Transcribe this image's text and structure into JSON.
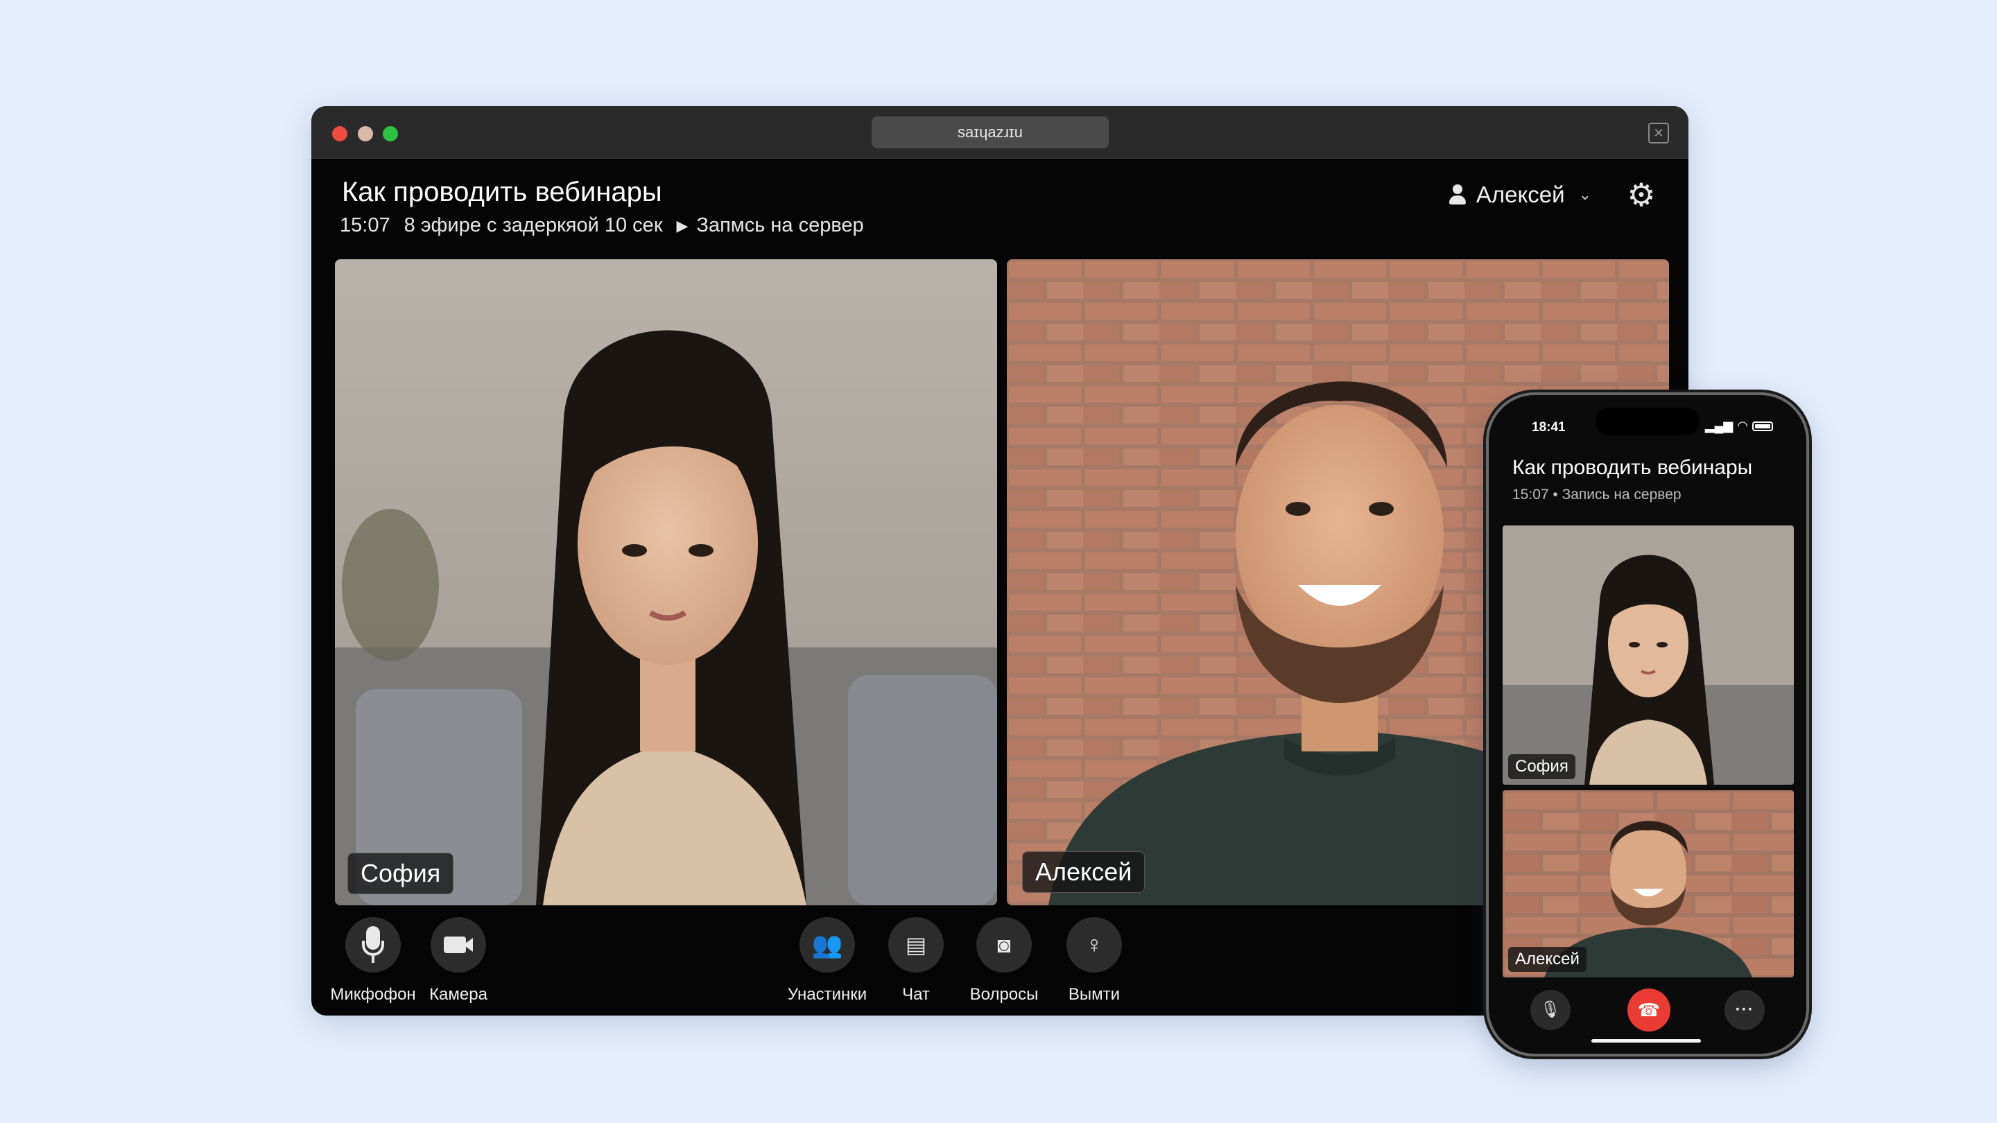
{
  "window": {
    "url": "saɪɥazɹɪu",
    "title": "Как проводить вебинары",
    "time": "15:07",
    "status": "8 эфире с задеркяой 10 сек",
    "recording": "Запмсь на сервер",
    "user": "Алексей"
  },
  "participants": [
    {
      "name": "София"
    },
    {
      "name": "Алексей"
    }
  ],
  "controls": {
    "mic": "Микфофон",
    "camera": "Камера",
    "participants": "Унастинки",
    "chat": "Чат",
    "questions": "Волросы",
    "exit": "Вымти"
  },
  "phone": {
    "clock": "18:41",
    "title": "Как проводить вебинары",
    "subtitle": "15:07 • Запись на сервер",
    "tiles": [
      {
        "name": "София"
      },
      {
        "name": "Алексей"
      }
    ]
  },
  "colors": {
    "background": "#e3edfc",
    "window": "#050505",
    "end_call": "#ea3b35"
  }
}
